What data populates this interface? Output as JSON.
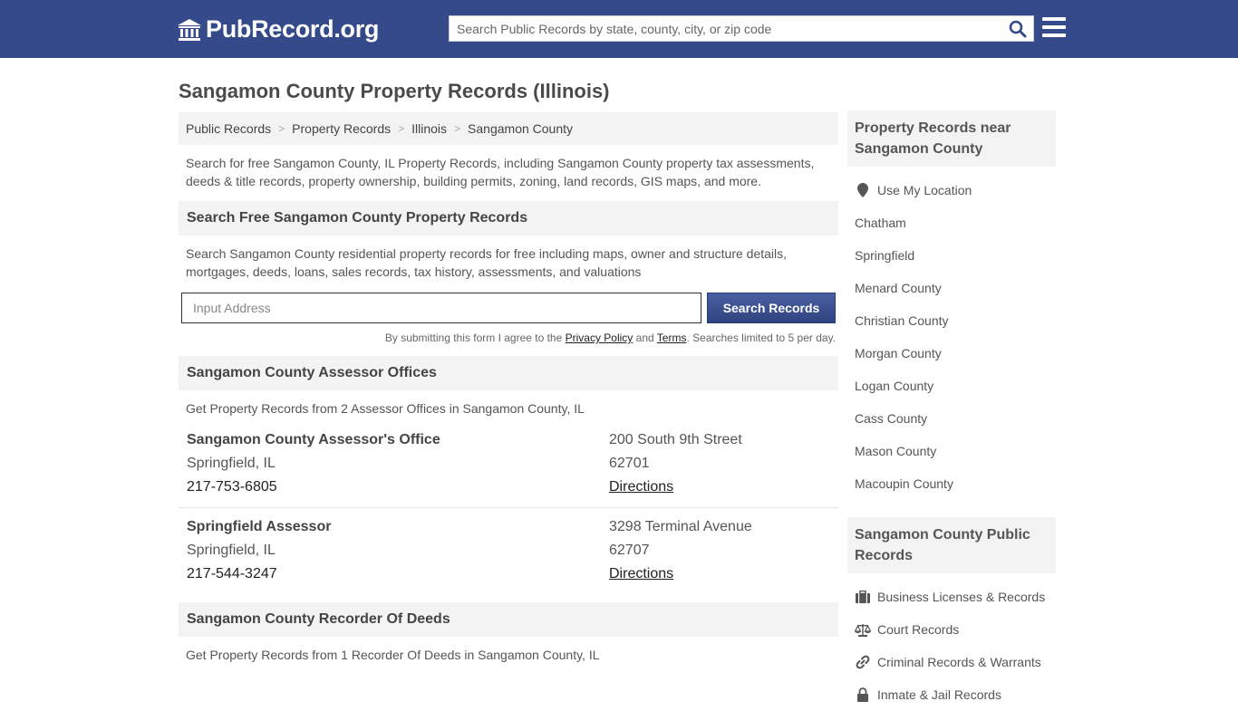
{
  "header": {
    "logo_text": "PubRecord.org",
    "search_placeholder": "Search Public Records by state, county, city, or zip code",
    "brand_color": "#354a8b"
  },
  "page": {
    "title": "Sangamon County Property Records (Illinois)"
  },
  "breadcrumb": [
    "Public Records",
    "Property Records",
    "Illinois",
    "Sangamon County"
  ],
  "intro": "Search for free Sangamon County, IL Property Records, including Sangamon County property tax assessments, deeds & title records, property ownership, building permits, zoning, land records, GIS maps, and more.",
  "search_section": {
    "heading": "Search Free Sangamon County Property Records",
    "description": "Search Sangamon County residential property records for free including maps, owner and structure details, mortgages, deeds, loans, sales records, tax history, assessments, and valuations",
    "address_placeholder": "Input Address",
    "button_label": "Search Records",
    "disclaimer_prefix": "By submitting this form I agree to the ",
    "privacy_label": "Privacy Policy",
    "and_text": " and ",
    "terms_label": "Terms",
    "disclaimer_suffix": ". Searches limited to 5 per day."
  },
  "assessor_section": {
    "heading": "Sangamon County Assessor Offices",
    "description": "Get Property Records from 2 Assessor Offices in Sangamon County, IL",
    "offices": [
      {
        "name": "Sangamon County Assessor's Office",
        "city": "Springfield, IL",
        "phone": "217-753-6805",
        "street": "200 South 9th Street",
        "zip": "62701",
        "directions_label": "Directions"
      },
      {
        "name": "Springfield Assessor",
        "city": "Springfield, IL",
        "phone": "217-544-3247",
        "street": "3298 Terminal Avenue",
        "zip": "62707",
        "directions_label": "Directions"
      }
    ]
  },
  "recorder_section": {
    "heading": "Sangamon County Recorder Of Deeds",
    "description": "Get Property Records from 1 Recorder Of Deeds in Sangamon County, IL"
  },
  "sidebar": {
    "nearby_heading": "Property Records near Sangamon County",
    "use_location_label": "Use My Location",
    "nearby": [
      "Chatham",
      "Springfield",
      "Menard County",
      "Christian County",
      "Morgan County",
      "Logan County",
      "Cass County",
      "Mason County",
      "Macoupin County"
    ],
    "public_heading": "Sangamon County Public Records",
    "public_records": [
      {
        "label": "Business Licenses & Records",
        "icon": "briefcase-icon"
      },
      {
        "label": "Court Records",
        "icon": "scale-icon"
      },
      {
        "label": "Criminal Records & Warrants",
        "icon": "link-icon"
      },
      {
        "label": "Inmate & Jail Records",
        "icon": "lock-icon"
      }
    ]
  }
}
